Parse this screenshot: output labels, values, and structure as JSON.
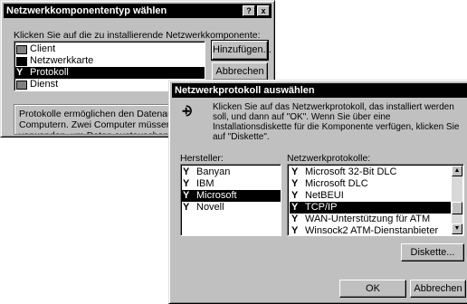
{
  "dialog1": {
    "title": "Netzwerkkomponententyp wählen",
    "help_btn": "?",
    "close_btn": "x",
    "instruction": "Klicken Sie auf die zu installierende Netzwerkkomponente:",
    "items": [
      {
        "label": "Client",
        "icon": "computer-icon"
      },
      {
        "label": "Netzwerkkarte",
        "icon": "network-card-icon"
      },
      {
        "label": "Protokoll",
        "icon": "protocol-icon"
      },
      {
        "label": "Dienst",
        "icon": "service-icon"
      }
    ],
    "selected_index": 2,
    "add_button": "Hinzufügen...",
    "cancel_button": "Abbrechen",
    "description": "Protokolle ermöglichen den Datenaustausch zwischen Computern. Zwei Computer müssen dasselbe Protokoll verwenden, um Daten austauschen zu können."
  },
  "dialog2": {
    "title": "Netzwerkprotokoll auswählen",
    "instruction": "Klicken Sie auf das Netzwerkprotokoll, das installiert werden soll, und dann auf \"OK\". Wenn Sie über eine Installationsdiskette für die Komponente verfügen, klicken Sie auf \"Diskette\".",
    "manufacturer_label": "Hersteller:",
    "protocols_label": "Netzwerkprotokolle:",
    "manufacturers": [
      "Banyan",
      "IBM",
      "Microsoft",
      "Novell"
    ],
    "manufacturer_selected": 2,
    "protocols": [
      "Microsoft 32-Bit DLC",
      "Microsoft DLC",
      "NetBEUI",
      "TCP/IP",
      "WAN-Unterstützung für ATM",
      "Winsock2 ATM-Dienstanbieter"
    ],
    "protocol_selected": 3,
    "disk_button": "Diskette...",
    "ok_button": "OK",
    "cancel_button": "Abbrechen"
  }
}
